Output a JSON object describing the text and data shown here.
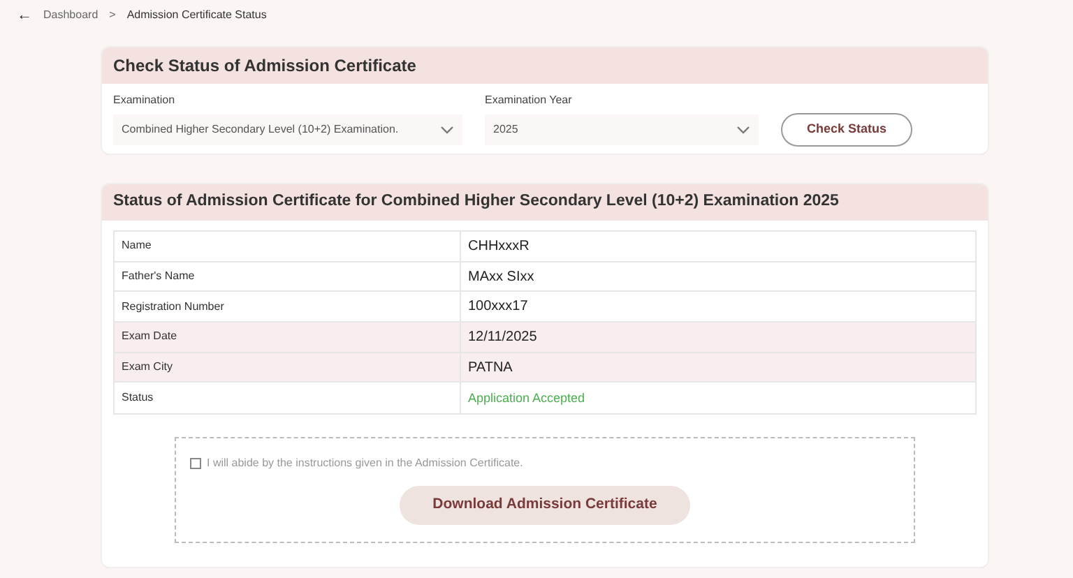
{
  "breadcrumb": {
    "back": "←",
    "items": [
      "Dashboard",
      ">",
      "Admission Certificate Status"
    ]
  },
  "check_card": {
    "title": "Check Status of Admission Certificate",
    "examination": {
      "label": "Examination",
      "value": "Combined Higher Secondary Level (10+2) Examination."
    },
    "year": {
      "label": "Examination Year",
      "value": "2025"
    },
    "button": "Check Status"
  },
  "status_card": {
    "title": "Status of Admission Certificate for Combined Higher Secondary Level (10+2) Examination 2025",
    "rows": [
      {
        "label": "Name",
        "value": "CHHxxxR",
        "shaded": false,
        "kind": "plain"
      },
      {
        "label": "Father's Name",
        "value": "MAxx SIxx",
        "shaded": false,
        "kind": "plain"
      },
      {
        "label": "Registration Number",
        "value": "100xxx17",
        "shaded": false,
        "kind": "plain"
      },
      {
        "label": "Exam Date",
        "value": "12/11/2025",
        "shaded": true,
        "kind": "plain"
      },
      {
        "label": "Exam City",
        "value": "PATNA",
        "shaded": true,
        "kind": "plain"
      },
      {
        "label": "Status",
        "value": "Application Accepted",
        "shaded": false,
        "kind": "status"
      }
    ],
    "agreement": {
      "text": "I will abide by the instructions given in the Admission Certificate.",
      "checked": false
    },
    "download_button": "Download Admission Certificate"
  }
}
